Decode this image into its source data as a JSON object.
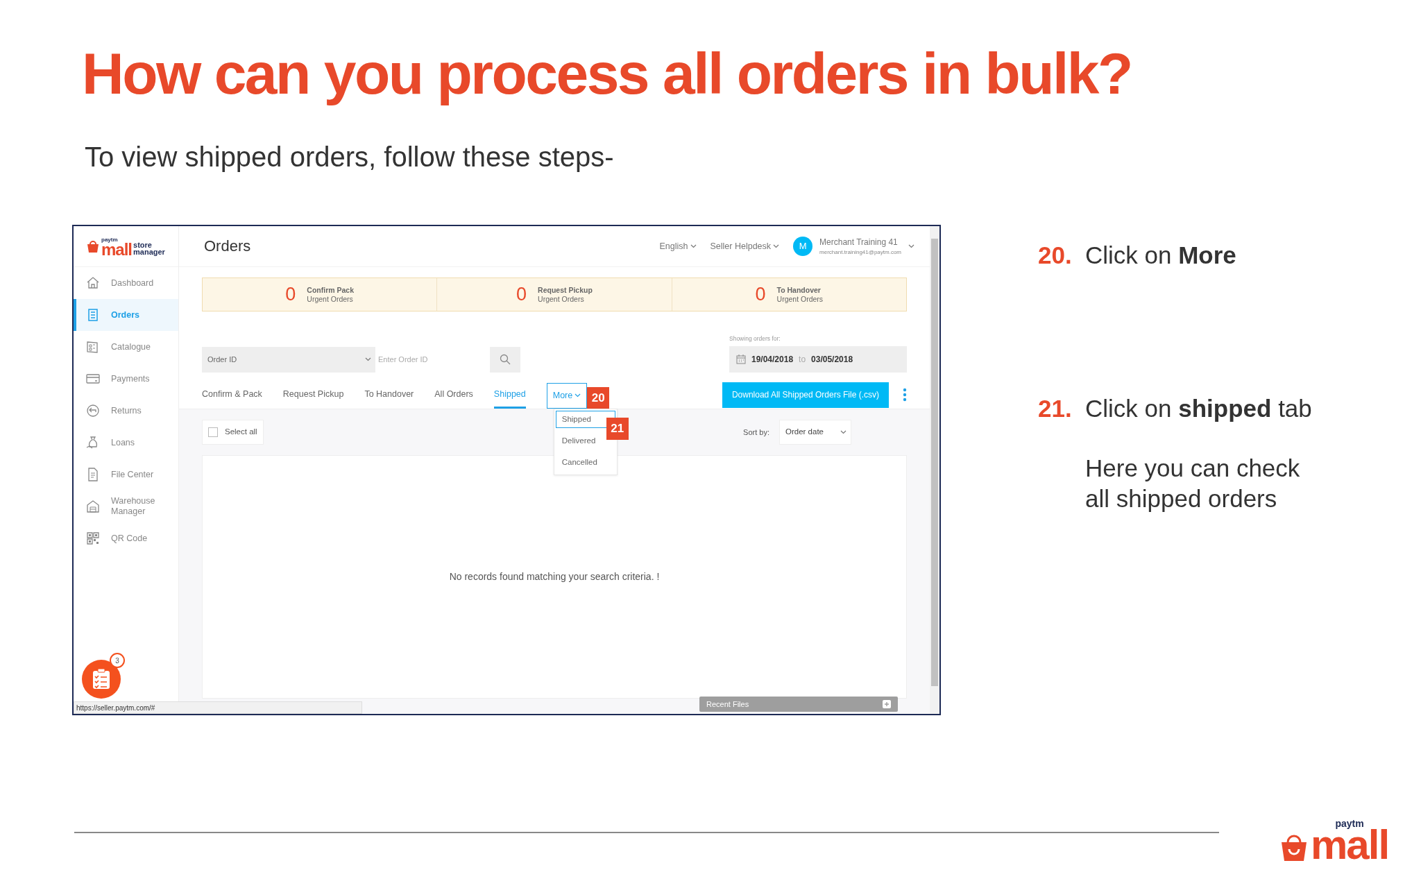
{
  "slide": {
    "title": "How can you process all orders in bulk?",
    "subtitle": "To view shipped orders, follow these steps-",
    "steps": [
      {
        "number": "20.",
        "text": "Click on **More**"
      },
      {
        "number": "21.",
        "text": "Click on **shipped** tab",
        "note": "Here you can check all shipped orders"
      }
    ],
    "logo": {
      "brand": "paytm",
      "name": "mall"
    }
  },
  "app": {
    "logo": {
      "brand": "paytm",
      "name": "mall",
      "line_1": "store",
      "line_2": "manager"
    },
    "sidebar": {
      "items": [
        {
          "label": "Dashboard",
          "selected": false
        },
        {
          "label": "Orders",
          "selected": true
        },
        {
          "label": "Catalogue",
          "selected": false
        },
        {
          "label": "Payments",
          "selected": false
        },
        {
          "label": "Returns",
          "selected": false
        },
        {
          "label": "Loans",
          "selected": false
        },
        {
          "label": "File Center",
          "selected": false
        },
        {
          "label": "Warehouse Manager",
          "selected": false
        },
        {
          "label": "QR Code",
          "selected": false
        }
      ]
    },
    "header": {
      "title": "Orders",
      "language": "English",
      "helpdesk": "Seller Helpdesk",
      "user": {
        "initial": "M",
        "name": "Merchant Training 41",
        "email": "merchant.training41@paytm.com"
      }
    },
    "urgent": [
      {
        "count": "0",
        "title": "Confirm Pack",
        "subtitle": "Urgent Orders"
      },
      {
        "count": "0",
        "title": "Request Pickup",
        "subtitle": "Urgent Orders"
      },
      {
        "count": "0",
        "title": "To Handover",
        "subtitle": "Urgent Orders"
      }
    ],
    "search": {
      "field": "Order ID",
      "placeholder": "Enter Order ID"
    },
    "date_range": {
      "label": "Showing orders for:",
      "from": "19/04/2018",
      "separator": "to",
      "to": "03/05/2018"
    },
    "tabs": [
      {
        "label": "Confirm & Pack",
        "selected": false
      },
      {
        "label": "Request Pickup",
        "selected": false
      },
      {
        "label": "To Handover",
        "selected": false
      },
      {
        "label": "All Orders",
        "selected": false
      },
      {
        "label": "Shipped",
        "selected": true
      }
    ],
    "more": {
      "label": "More",
      "expanded": true,
      "callout": "20",
      "items": [
        {
          "label": "Shipped",
          "selected": true,
          "callout": "21"
        },
        {
          "label": "Delivered",
          "selected": false
        },
        {
          "label": "Cancelled",
          "selected": false
        }
      ]
    },
    "download_button": "Download All Shipped Orders File (.csv)",
    "select_all": {
      "label": "Select all",
      "checked": false
    },
    "sort": {
      "label": "Sort by:",
      "value": "Order date"
    },
    "empty_message": "No records found matching your search criteria. !",
    "fab_badge": "3",
    "recent_files": "Recent Files",
    "status_url": "https://seller.paytm.com/#"
  }
}
